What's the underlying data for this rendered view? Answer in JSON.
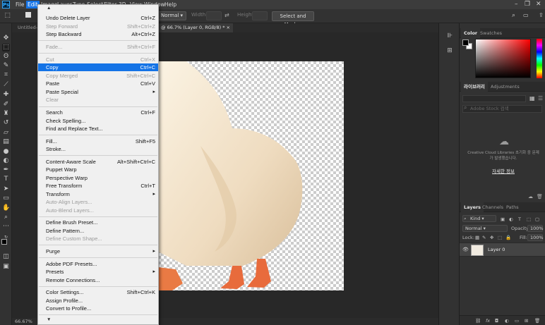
{
  "app": {
    "logo": "Ps",
    "menu": [
      "File",
      "Edit",
      "Image",
      "Layer",
      "Type",
      "Select",
      "Filter",
      "3D",
      "View",
      "Window",
      "Help"
    ],
    "active_menu": "Edit"
  },
  "options_bar": {
    "style_value": "Normal",
    "width_label": "Width:",
    "height_label": "Height:",
    "select_mask_label": "Select and Mask..."
  },
  "doc_tabs": [
    {
      "label": "Untitled-",
      "active": false
    },
    {
      "label": "@ 66.7% (Layer 0, RGB/8) * ×",
      "active": true
    }
  ],
  "status": {
    "zoom": "66.67%"
  },
  "color_panel": {
    "tabs": [
      "Color",
      "Swatches"
    ],
    "fg_color": "#000000",
    "bg_color": "#ffffff"
  },
  "libraries_panel": {
    "tabs": [
      "라이브러리",
      "Adjustments"
    ],
    "search_placeholder": "Adobe Stock 검색",
    "message": "Creative Cloud Libraries 초기화 중 문제가 발생했습니다.",
    "link": "자세한 정보"
  },
  "layers_panel": {
    "tabs": [
      "Layers",
      "Channels",
      "Paths"
    ],
    "filter_label": "Kind",
    "blend_mode": "Normal",
    "opacity_label": "Opacity:",
    "opacity_value": "100%",
    "lock_label": "Lock:",
    "fill_label": "Fill:",
    "fill_value": "100%",
    "layers": [
      {
        "name": "Layer 0"
      }
    ]
  },
  "edit_menu": {
    "items": [
      {
        "label": "Undo Delete Layer",
        "shortcut": "Ctrl+Z",
        "disabled": false
      },
      {
        "label": "Step Forward",
        "shortcut": "Shift+Ctrl+Z",
        "disabled": true
      },
      {
        "label": "Step Backward",
        "shortcut": "Alt+Ctrl+Z",
        "disabled": false
      },
      {
        "label": "Fade...",
        "shortcut": "Shift+Ctrl+F",
        "disabled": true
      },
      {
        "label": "Cut",
        "shortcut": "Ctrl+X",
        "disabled": true
      },
      {
        "label": "Copy",
        "shortcut": "Ctrl+C",
        "disabled": false,
        "highlighted": true
      },
      {
        "label": "Copy Merged",
        "shortcut": "Shift+Ctrl+C",
        "disabled": true
      },
      {
        "label": "Paste",
        "shortcut": "Ctrl+V",
        "disabled": false
      },
      {
        "label": "Paste Special",
        "shortcut": "",
        "submenu": true,
        "disabled": false
      },
      {
        "label": "Clear",
        "shortcut": "",
        "disabled": true
      },
      {
        "label": "Search",
        "shortcut": "Ctrl+F",
        "disabled": false
      },
      {
        "label": "Check Spelling...",
        "shortcut": "",
        "disabled": false
      },
      {
        "label": "Find and Replace Text...",
        "shortcut": "",
        "disabled": false
      },
      {
        "label": "Fill...",
        "shortcut": "Shift+F5",
        "disabled": false
      },
      {
        "label": "Stroke...",
        "shortcut": "",
        "disabled": false
      },
      {
        "label": "Content-Aware Scale",
        "shortcut": "Alt+Shift+Ctrl+C",
        "disabled": false
      },
      {
        "label": "Puppet Warp",
        "shortcut": "",
        "disabled": false
      },
      {
        "label": "Perspective Warp",
        "shortcut": "",
        "disabled": false
      },
      {
        "label": "Free Transform",
        "shortcut": "Ctrl+T",
        "disabled": false
      },
      {
        "label": "Transform",
        "shortcut": "",
        "submenu": true,
        "disabled": false
      },
      {
        "label": "Auto-Align Layers...",
        "shortcut": "",
        "disabled": true
      },
      {
        "label": "Auto-Blend Layers...",
        "shortcut": "",
        "disabled": true
      },
      {
        "label": "Define Brush Preset...",
        "shortcut": "",
        "disabled": false
      },
      {
        "label": "Define Pattern...",
        "shortcut": "",
        "disabled": false
      },
      {
        "label": "Define Custom Shape...",
        "shortcut": "",
        "disabled": true
      },
      {
        "label": "Purge",
        "shortcut": "",
        "submenu": true,
        "disabled": false
      },
      {
        "label": "Adobe PDF Presets...",
        "shortcut": "",
        "disabled": false
      },
      {
        "label": "Presets",
        "shortcut": "",
        "submenu": true,
        "disabled": false
      },
      {
        "label": "Remote Connections...",
        "shortcut": "",
        "disabled": false
      },
      {
        "label": "Color Settings...",
        "shortcut": "Shift+Ctrl+K",
        "disabled": false
      },
      {
        "label": "Assign Profile...",
        "shortcut": "",
        "disabled": false
      },
      {
        "label": "Convert to Profile...",
        "shortcut": "",
        "disabled": false
      }
    ]
  }
}
